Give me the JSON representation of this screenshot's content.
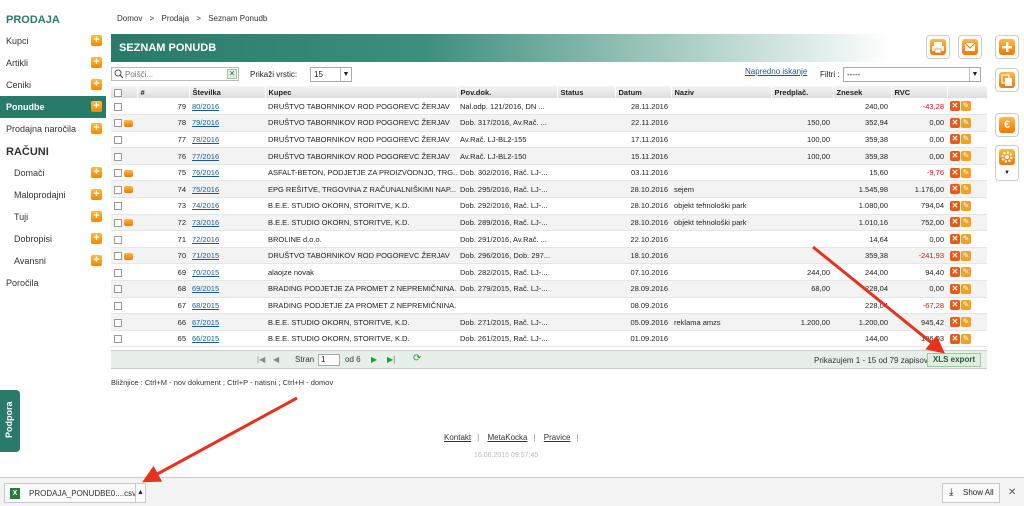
{
  "sidebar": {
    "section1": "PRODAJA",
    "items1": [
      {
        "label": "Kupci",
        "plus": true
      },
      {
        "label": "Artikli",
        "plus": true
      },
      {
        "label": "Ceniki",
        "plus": true
      },
      {
        "label": "Ponudbe",
        "plus": true,
        "active": true
      },
      {
        "label": "Prodajna naročila",
        "plus": true
      }
    ],
    "section2": "RAČUNI",
    "items2": [
      {
        "label": "Domači",
        "plus": true
      },
      {
        "label": "Maloprodajni",
        "plus": true
      },
      {
        "label": "Tuji",
        "plus": true
      },
      {
        "label": "Dobropisi",
        "plus": true
      },
      {
        "label": "Avansni",
        "plus": true
      }
    ],
    "porocila": "Poročila",
    "podpora": "Podpora"
  },
  "breadcrumb": [
    "Domov",
    ">",
    "Prodaja",
    ">",
    "Seznam Ponudb"
  ],
  "page_title": "SEZNAM PONUDB",
  "toolbar": {
    "search_placeholder": "Poišči...",
    "rows_label": "Prikaži vrstic:",
    "rows_value": "15",
    "advanced_search": "Napredno iskanje",
    "filter_label": "Filtri :",
    "filter_value": "-----"
  },
  "table": {
    "headers": [
      "",
      "#",
      "Številka",
      "Kupec",
      "Pov.dok.",
      "Status",
      "Datum",
      "Naziv",
      "Predplač.",
      "Znesek",
      "RVC",
      ""
    ],
    "rows": [
      {
        "print": false,
        "n": "79",
        "num": "80/2016",
        "kupec": "DRUŠTVO TABORNIKOV ROD POGOREVC ŽERJAV",
        "pov": "Nal.odp. 121/2016, DN ...",
        "status": "",
        "datum": "28.11.2016",
        "naziv": "",
        "pred": "",
        "znesek": "240,00",
        "rvc": "-43,28",
        "neg": true
      },
      {
        "print": true,
        "n": "78",
        "num": "79/2016",
        "kupec": "DRUŠTVO TABORNIKOV ROD POGOREVC ŽERJAV",
        "pov": "Dob. 317/2016, Av.Rač. ...",
        "status": "",
        "datum": "22.11.2016",
        "naziv": "",
        "pred": "150,00",
        "znesek": "352,94",
        "rvc": "0,00",
        "neg": false
      },
      {
        "print": false,
        "n": "77",
        "num": "78/2016",
        "kupec": "DRUŠTVO TABORNIKOV ROD POGOREVC ŽERJAV",
        "pov": "Av.Rač. LJ-BL2-155",
        "status": "",
        "datum": "17.11.2016",
        "naziv": "",
        "pred": "100,00",
        "znesek": "359,38",
        "rvc": "0,00",
        "neg": false
      },
      {
        "print": false,
        "n": "76",
        "num": "77/2016",
        "kupec": "DRUŠTVO TABORNIKOV ROD POGOREVC ŽERJAV",
        "pov": "Av.Rač. LJ-BL2-150",
        "status": "",
        "datum": "15.11.2016",
        "naziv": "",
        "pred": "100,00",
        "znesek": "359,38",
        "rvc": "0,00",
        "neg": false
      },
      {
        "print": true,
        "n": "75",
        "num": "76/2016",
        "kupec": "ASFALT-BETON, PODJETJE ZA PROIZVODNJO, TRG...",
        "pov": "Dob. 302/2016, Rač. LJ-...",
        "status": "",
        "datum": "03.11.2016",
        "naziv": "",
        "pred": "",
        "znesek": "15,60",
        "rvc": "-9,76",
        "neg": true
      },
      {
        "print": true,
        "n": "74",
        "num": "75/2016",
        "kupec": "EPG REŠITVE, TRGOVINA Z RAČUNALNIŠKIMI NAP...",
        "pov": "Dob. 295/2016, Rač. LJ-...",
        "status": "",
        "datum": "28.10.2016",
        "naziv": "sejem",
        "pred": "",
        "znesek": "1.545,98",
        "rvc": "1.176,00",
        "neg": false
      },
      {
        "print": false,
        "n": "73",
        "num": "74/2016",
        "kupec": "B.E.E. STUDIO OKORN, STORITVE, K.D.",
        "pov": "Dob. 292/2016, Rač. LJ-...",
        "status": "",
        "datum": "28.10.2016",
        "naziv": "objekt tehnološki park",
        "pred": "",
        "znesek": "1.080,00",
        "rvc": "794,04",
        "neg": false
      },
      {
        "print": true,
        "n": "72",
        "num": "73/2016",
        "kupec": "B.E.E. STUDIO OKORN, STORITVE, K.D.",
        "pov": "Dob. 289/2016, Rač. LJ-...",
        "status": "",
        "datum": "28.10.2016",
        "naziv": "objekt tehnološki park",
        "pred": "",
        "znesek": "1.010,16",
        "rvc": "752,00",
        "neg": false
      },
      {
        "print": false,
        "n": "71",
        "num": "72/2016",
        "kupec": "BROLINE d.o.o.",
        "pov": "Dob. 291/2016, Av.Rač. ...",
        "status": "",
        "datum": "22.10.2016",
        "naziv": "",
        "pred": "",
        "znesek": "14,64",
        "rvc": "0,00",
        "neg": false
      },
      {
        "print": true,
        "n": "70",
        "num": "71/2015",
        "kupec": "DRUŠTVO TABORNIKOV ROD POGOREVC ŽERJAV",
        "pov": "Dob. 296/2016, Dob. 297...",
        "status": "",
        "datum": "18.10.2016",
        "naziv": "",
        "pred": "",
        "znesek": "359,38",
        "rvc": "-241,93",
        "neg": true
      },
      {
        "print": false,
        "n": "69",
        "num": "70/2015",
        "kupec": "alaojze novak",
        "pov": "Dob. 282/2015, Rač. LJ-...",
        "status": "",
        "datum": "07.10.2016",
        "naziv": "",
        "pred": "244,00",
        "znesek": "244,00",
        "rvc": "94,40",
        "neg": false
      },
      {
        "print": false,
        "n": "68",
        "num": "69/2015",
        "kupec": "BRADING PODJETJE ZA PROMET Z NEPREMIČNINA...",
        "pov": "Dob. 279/2015, Rač. LJ-...",
        "status": "",
        "datum": "28.09.2016",
        "naziv": "",
        "pred": "68,00",
        "znesek": "228,04",
        "rvc": "0,00",
        "neg": false
      },
      {
        "print": false,
        "n": "67",
        "num": "68/2015",
        "kupec": "BRADING PODJETJE ZA PROMET Z NEPREMIČNINA...",
        "pov": "",
        "status": "",
        "datum": "08.09.2016",
        "naziv": "",
        "pred": "",
        "znesek": "228,04",
        "rvc": "-67,28",
        "neg": true
      },
      {
        "print": false,
        "n": "66",
        "num": "67/2015",
        "kupec": "B.E.E. STUDIO OKORN, STORITVE, K.D.",
        "pov": "Dob. 271/2015, Rač. LJ-...",
        "status": "",
        "datum": "05.09.2016",
        "naziv": "reklama amzs",
        "pred": "1.200,00",
        "znesek": "1.200,00",
        "rvc": "945,42",
        "neg": false
      },
      {
        "print": false,
        "n": "65",
        "num": "66/2015",
        "kupec": "B.E.E. STUDIO OKORN, STORITVE, K.D.",
        "pov": "Dob. 261/2015, Rač. LJ-...",
        "status": "",
        "datum": "01.09.2016",
        "naziv": "",
        "pred": "",
        "znesek": "144,00",
        "rvc": "106,03",
        "neg": false
      }
    ]
  },
  "pager": {
    "page_label": "Stran",
    "page_value": "1",
    "of_label": "od 6",
    "info": "Prikazujem 1 - 15 od 79 zapisov.",
    "xls_label": "XLS export"
  },
  "shortcuts": "Bližnjice : Ctrl+M - nov dokument ;   Ctrl+P - natisni ;   Ctrl+H - domov",
  "footer": {
    "links": [
      "Kontakt",
      "MetaKocka",
      "Pravice"
    ],
    "timestamp": "16.06.2016 09:57:45"
  },
  "download_bar": {
    "file_name": "PRODAJA_PONUDBE0....csv",
    "file_icon": "excel-file-icon",
    "show_all": "Show All"
  },
  "colors": {
    "brand": "#2a7a6a",
    "accent": "#f08a00",
    "negative": "#dd1111",
    "annotation_arrow": "#e8321e"
  }
}
